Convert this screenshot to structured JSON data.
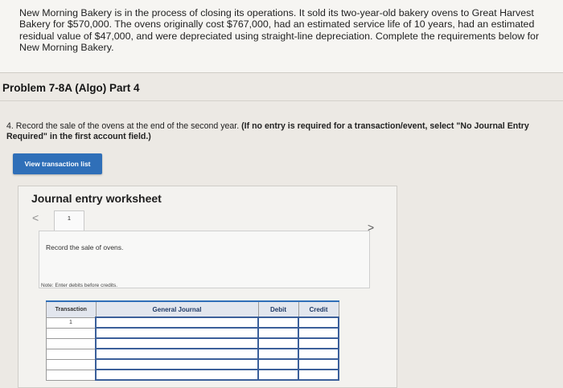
{
  "intro": {
    "text": "New Morning Bakery is in the process of closing its operations. It sold its two-year-old bakery ovens to Great Harvest Bakery for $570,000. The ovens originally cost $767,000, had an estimated service life of 10 years, had an estimated residual value of $47,000, and were depreciated using straight-line depreciation. Complete the requirements below for New Morning Bakery."
  },
  "problem": {
    "title": "Problem 7-8A (Algo) Part 4"
  },
  "requirement": {
    "prefix": "4. Record the sale of the ovens at the end of the second year.",
    "bold": "(If no entry is required for a transaction/event, select \"No Journal Entry Required\" in the first account field.)"
  },
  "view_button": {
    "label": "View transaction list"
  },
  "worksheet": {
    "title": "Journal entry worksheet",
    "nav_prev": "<",
    "nav_next": ">",
    "tab_number": "1",
    "description": "Record the sale of ovens.",
    "note": "Note: Enter debits before credits."
  },
  "journal_table": {
    "headers": [
      "Transaction",
      "General Journal",
      "Debit",
      "Credit"
    ],
    "rows": [
      {
        "transaction": "1",
        "account": "",
        "debit": "",
        "credit": ""
      },
      {
        "transaction": "",
        "account": "",
        "debit": "",
        "credit": ""
      },
      {
        "transaction": "",
        "account": "",
        "debit": "",
        "credit": ""
      },
      {
        "transaction": "",
        "account": "",
        "debit": "",
        "credit": ""
      },
      {
        "transaction": "",
        "account": "",
        "debit": "",
        "credit": ""
      },
      {
        "transaction": "",
        "account": "",
        "debit": "",
        "credit": ""
      }
    ]
  },
  "colors": {
    "button": "#2f6fb8",
    "table_border": "#3b5f9a",
    "background": "#ece9e4"
  }
}
